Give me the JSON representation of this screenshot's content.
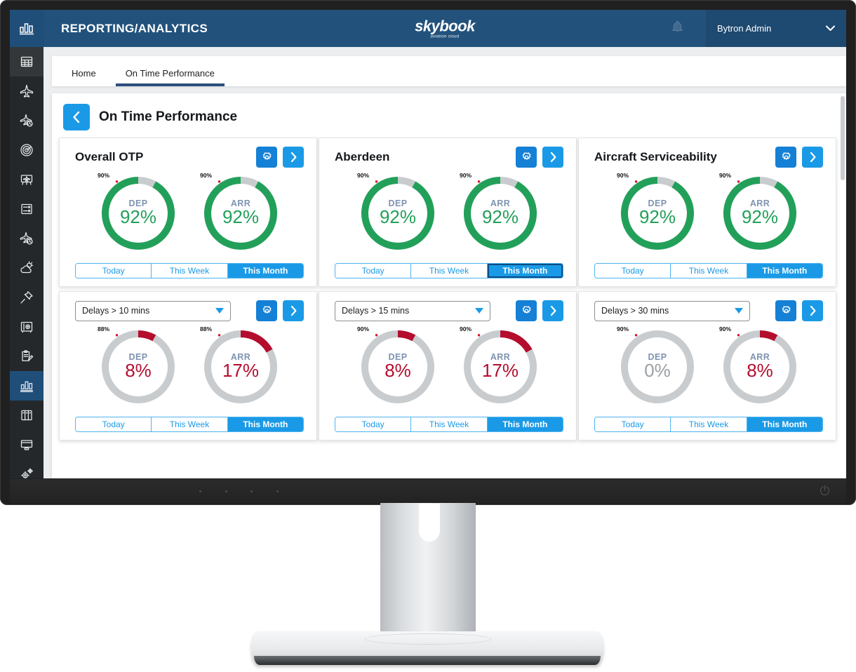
{
  "topbar": {
    "app_title": "REPORTING/ANALYTICS",
    "brand_name": "skybook",
    "brand_sub": "aviation cloud",
    "bell_icon": "bell-icon",
    "user_name": "Bytron Admin",
    "chevron_icon": "chevron-down-icon"
  },
  "sidebar": {
    "logo_icon": "bar-chart-icon",
    "items": [
      {
        "icon": "grid-icon",
        "active": false,
        "highlight": true
      },
      {
        "icon": "airplane-icon",
        "active": false
      },
      {
        "icon": "airplane-clock-icon",
        "active": false
      },
      {
        "icon": "radar-icon",
        "active": false
      },
      {
        "icon": "airplane-board-icon",
        "active": false
      },
      {
        "icon": "list-panel-icon",
        "active": false
      },
      {
        "icon": "airplane-clock-2-icon",
        "active": false
      },
      {
        "icon": "weather-icon",
        "active": false
      },
      {
        "icon": "pushpin-icon",
        "active": false
      },
      {
        "icon": "safe-icon",
        "active": false
      },
      {
        "icon": "clipboard-edit-icon",
        "active": false
      },
      {
        "icon": "bar-chart-icon",
        "active": true
      },
      {
        "icon": "books-icon",
        "active": false
      },
      {
        "icon": "window-icon",
        "active": false
      },
      {
        "icon": "gears-icon",
        "active": false
      }
    ]
  },
  "tabs": [
    {
      "label": "Home",
      "active": false
    },
    {
      "label": "On Time Performance",
      "active": true
    }
  ],
  "page": {
    "back_icon": "chevron-left-icon",
    "title": "On Time Performance"
  },
  "colors": {
    "brand_blue": "#22527c",
    "accent_blue": "#1a9ae6",
    "gear_blue": "#1480d6",
    "green": "#22a05a",
    "red": "#b40d2e",
    "grey_track": "#c9ccce",
    "label_grey": "#7e93b0",
    "sidebar_dark": "#25282b"
  },
  "period_options": [
    "Today",
    "This Week",
    "This Month"
  ],
  "chart_data": [
    {
      "type": "pie",
      "id": "overall-otp",
      "title": "Overall OTP",
      "header_kind": "title",
      "gear_icon": "gear-icon",
      "next_icon": "chevron-right-icon",
      "threshold": 90,
      "threshold_label": "90%",
      "selected_period": "This Month",
      "period_focus": false,
      "gauges": [
        {
          "label": "DEP",
          "value": 92,
          "value_label": "92%",
          "color": "#22a05a",
          "track": "#c9ccce",
          "start_deg": 0,
          "sweep_deg": 331
        },
        {
          "label": "ARR",
          "value": 92,
          "value_label": "92%",
          "color": "#22a05a",
          "track": "#c9ccce",
          "start_deg": 0,
          "sweep_deg": 331
        }
      ]
    },
    {
      "type": "pie",
      "id": "aberdeen",
      "title": "Aberdeen",
      "header_kind": "title",
      "gear_icon": "gear-icon",
      "next_icon": "chevron-right-icon",
      "threshold": 90,
      "threshold_label": "90%",
      "selected_period": "This Month",
      "period_focus": true,
      "gauges": [
        {
          "label": "DEP",
          "value": 92,
          "value_label": "92%",
          "color": "#22a05a",
          "track": "#c9ccce",
          "start_deg": 0,
          "sweep_deg": 331
        },
        {
          "label": "ARR",
          "value": 92,
          "value_label": "92%",
          "color": "#22a05a",
          "track": "#c9ccce",
          "start_deg": 0,
          "sweep_deg": 331
        }
      ]
    },
    {
      "type": "pie",
      "id": "aircraft-serviceability",
      "title": "Aircraft Serviceability",
      "header_kind": "title",
      "gear_icon": "gear-icon",
      "next_icon": "chevron-right-icon",
      "threshold": 90,
      "threshold_label": "90%",
      "selected_period": "This Month",
      "period_focus": false,
      "gauges": [
        {
          "label": "DEP",
          "value": 92,
          "value_label": "92%",
          "color": "#22a05a",
          "track": "#c9ccce",
          "start_deg": 0,
          "sweep_deg": 331
        },
        {
          "label": "ARR",
          "value": 92,
          "value_label": "92%",
          "color": "#22a05a",
          "track": "#c9ccce",
          "start_deg": 0,
          "sweep_deg": 331
        }
      ]
    },
    {
      "type": "pie",
      "id": "delays-10",
      "title": "Delays > 10 mins",
      "header_kind": "dropdown",
      "gear_icon": "gear-icon",
      "next_icon": "chevron-right-icon",
      "threshold": 88,
      "threshold_label": "88%",
      "selected_period": "This Month",
      "period_focus": false,
      "gauges": [
        {
          "label": "DEP",
          "value": 8,
          "value_label": "8%",
          "color": "#b40d2e",
          "track": "#c9ccce",
          "start_deg": 0,
          "sweep_deg": 29
        },
        {
          "label": "ARR",
          "value": 17,
          "value_label": "17%",
          "color": "#b40d2e",
          "track": "#c9ccce",
          "start_deg": 0,
          "sweep_deg": 61
        }
      ]
    },
    {
      "type": "pie",
      "id": "delays-15",
      "title": "Delays > 15 mins",
      "header_kind": "dropdown",
      "gear_icon": "gear-icon",
      "next_icon": "chevron-right-icon",
      "threshold": 90,
      "threshold_label": "90%",
      "selected_period": "This Month",
      "period_focus": false,
      "gauges": [
        {
          "label": "DEP",
          "value": 8,
          "value_label": "8%",
          "color": "#b40d2e",
          "track": "#c9ccce",
          "start_deg": 0,
          "sweep_deg": 29
        },
        {
          "label": "ARR",
          "value": 17,
          "value_label": "17%",
          "color": "#b40d2e",
          "track": "#c9ccce",
          "start_deg": 0,
          "sweep_deg": 61
        }
      ]
    },
    {
      "type": "pie",
      "id": "delays-30",
      "title": "Delays > 30 mins",
      "header_kind": "dropdown",
      "gear_icon": "gear-icon",
      "next_icon": "chevron-right-icon",
      "threshold": 90,
      "threshold_label": "90%",
      "selected_period": "This Month",
      "period_focus": false,
      "gauges": [
        {
          "label": "DEP",
          "value": 0,
          "value_label": "0%",
          "color": "#9ba0a4",
          "track": "#c9ccce",
          "start_deg": 0,
          "sweep_deg": 0
        },
        {
          "label": "ARR",
          "value": 8,
          "value_label": "8%",
          "color": "#b40d2e",
          "track": "#c9ccce",
          "start_deg": 0,
          "sweep_deg": 29
        }
      ]
    }
  ],
  "monitor": {
    "power_icon": "power-icon",
    "chin_dots": 4
  }
}
